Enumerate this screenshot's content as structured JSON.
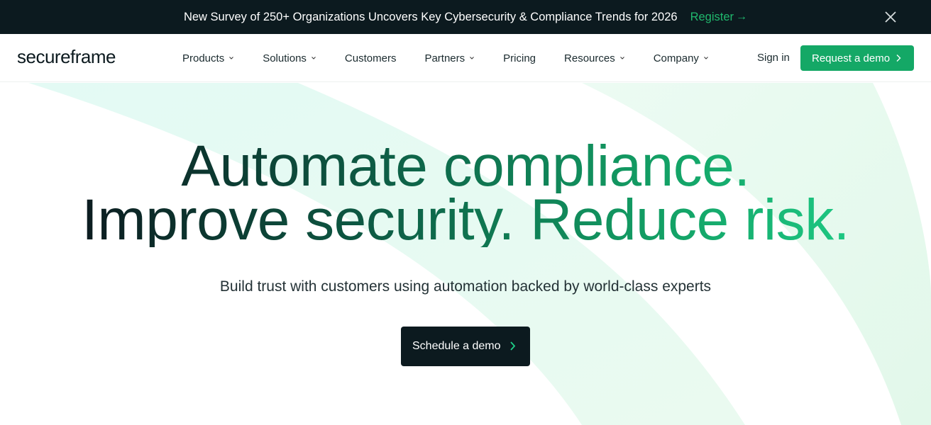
{
  "banner": {
    "message": "New Survey of 250+ Organizations Uncovers Key Cybersecurity & Compliance Trends for 2026",
    "register_label": "Register",
    "register_arrow": "→"
  },
  "nav": {
    "logo": "secureframe",
    "items": [
      {
        "label": "Products",
        "dropdown": true
      },
      {
        "label": "Solutions",
        "dropdown": true
      },
      {
        "label": "Customers",
        "dropdown": false
      },
      {
        "label": "Partners",
        "dropdown": true
      },
      {
        "label": "Pricing",
        "dropdown": false
      },
      {
        "label": "Resources",
        "dropdown": true
      },
      {
        "label": "Company",
        "dropdown": true
      }
    ],
    "sign_in": "Sign in",
    "cta": "Request a demo"
  },
  "hero": {
    "headline_line1": "Automate compliance.",
    "headline_line2": "Improve security. Reduce risk.",
    "subheadline": "Build trust with customers using automation backed by world-class experts",
    "cta": "Schedule a demo"
  },
  "colors": {
    "banner_bg": "#0c1a1f",
    "accent_green": "#14a866",
    "register_green": "#20b86d",
    "dark_button": "#0c1a1f"
  }
}
